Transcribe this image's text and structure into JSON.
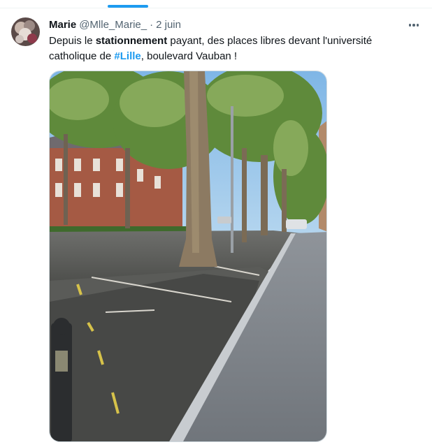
{
  "post": {
    "author_name": "Marie",
    "author_handle": "@Mlle_Marie_",
    "separator": "·",
    "date": "2 juin",
    "text": {
      "part1": "Depuis le ",
      "bold1": "stationnement",
      "part2": " payant, des places libres devant l'université catholique de ",
      "hashtag": "#Lille",
      "part3": ", boulevard Vauban !"
    }
  },
  "icons": {
    "more": "more-options-icon",
    "avatar": "user-avatar"
  },
  "colors": {
    "accent": "#1d9bf0",
    "text_primary": "#0f1419",
    "text_secondary": "#536471",
    "border": "#cfd9de"
  }
}
